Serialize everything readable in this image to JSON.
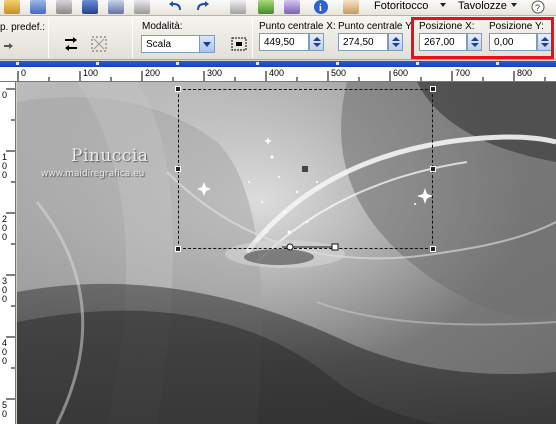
{
  "menu": {
    "fotoritocco": "Fotoritocco",
    "tavolozze": "Tavolozze"
  },
  "options": {
    "presets_label": "p. predef.:",
    "mode_label": "Modalità:",
    "mode_value": "Scala",
    "center_x_label": "Punto centrale X:",
    "center_x_value": "449,50",
    "center_y_label": "Punto centrale Y:",
    "center_y_value": "274,50",
    "pos_x_label": "Posizione X:",
    "pos_x_value": "267,00",
    "pos_y_label": "Posizione Y:",
    "pos_y_value": "0,00"
  },
  "ruler": {
    "top_numbers": [
      "0",
      "100",
      "200",
      "300",
      "400",
      "500",
      "600",
      "700",
      "800"
    ],
    "left_numbers": [
      [
        "0"
      ],
      [
        "1",
        "0",
        "0"
      ],
      [
        "2",
        "0",
        "0"
      ],
      [
        "3",
        "0",
        "0"
      ],
      [
        "4",
        "0",
        "0"
      ],
      [
        "5",
        "0",
        "0"
      ]
    ]
  },
  "canvas": {
    "watermark_title": "Pinuccia",
    "watermark_url": "www.maidiregrafica.eu"
  },
  "colors": {
    "highlight": "#e8101a",
    "title_strip": "#1b43b7",
    "input_border": "#7f9db9"
  },
  "icons": [
    "save-icon",
    "undo-icon",
    "redo-icon",
    "info-icon",
    "flip-icon",
    "reset-icon",
    "selection-tool-icon"
  ]
}
